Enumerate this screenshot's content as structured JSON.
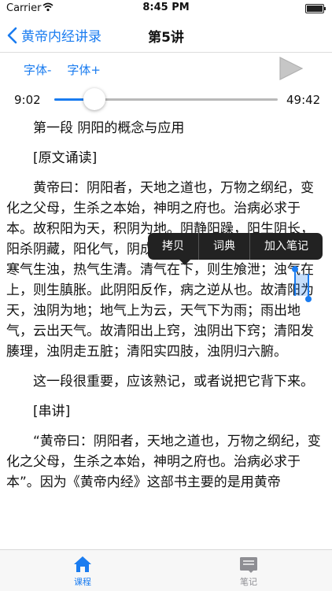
{
  "status": {
    "carrier": "Carrier",
    "time": "8:45 PM"
  },
  "nav": {
    "back_label": "黄帝内经讲录",
    "title": "第5讲"
  },
  "controls": {
    "font_minus": "字体-",
    "font_plus": "字体+"
  },
  "player": {
    "current_time": "9:02",
    "total_time": "49:42",
    "progress": 0.18
  },
  "content": {
    "heading": "第一段 阴阳的概念与应用",
    "section1": "[原文诵读]",
    "para1": "黄帝曰：阴阳者，天地之道也，万物之纲纪，变化之父母，生杀之本始，神明之府也。治病必求于本。故积阳为天，积阴为地。阴静阳躁，阳生阴长，阳杀阴藏，阳化气，阴成形。寒极生热，热极生寒。寒气生浊，热气生清。清气在下，则生飧泄；浊气在上，则生䐜胀。此阴阳反作，病之逆从也。故清阳为天，浊阴为地；地气上为云，天气下为雨；雨出地气，云出天气。故清阳出上窍，浊阴出下窍；清阳发腠理，浊阴走五脏；清阳实四肢，浊阴归六腑。",
    "para2": "这一段很重要，应该熟记，或者说把它背下来。",
    "section2": "[串讲]",
    "para3": "“黄帝曰：阴阳者，天地之道也，万物之纲纪，变化之父母，生杀之本始，神明之府也。治病必求于本”。因为《黄帝内经》这部书主要的是用黄帝"
  },
  "context_menu": {
    "copy": "拷贝",
    "dictionary": "词典",
    "add_note": "加入笔记"
  },
  "tabs": [
    {
      "label": "课程"
    },
    {
      "label": "笔记"
    }
  ],
  "colors": {
    "accent": "#1a7cf0",
    "inactive": "#8e8e93"
  }
}
